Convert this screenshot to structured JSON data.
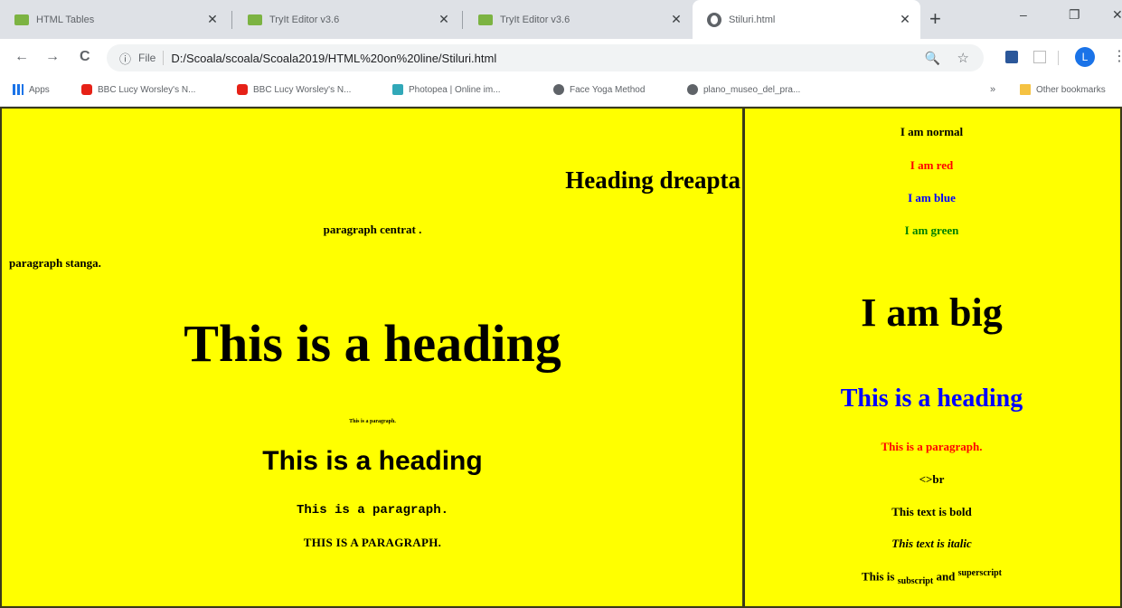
{
  "tabs": [
    {
      "title": "HTML Tables",
      "icon": "html-tables-favicon"
    },
    {
      "title": "TryIt Editor v3.6",
      "icon": "w3schools-favicon"
    },
    {
      "title": "TryIt Editor v3.6",
      "icon": "w3schools-favicon"
    },
    {
      "title": "Stiluri.html",
      "icon": "globe-icon"
    }
  ],
  "window_controls": {
    "minimize": "–",
    "maximize": "❐",
    "close": "✕"
  },
  "toolbar": {
    "back": "←",
    "forward": "→",
    "reload": "C",
    "info_icon": "ⓘ",
    "scheme_label": "File",
    "url": "D:/Scoala/scoala/Scoala2019/HTML%20on%20line/Stiluri.html",
    "profile_initial": "L"
  },
  "bookmarks": [
    {
      "label": "Apps",
      "icon": "apps"
    },
    {
      "label": "BBC Lucy Worsley's N...",
      "icon": "youtube"
    },
    {
      "label": "BBC Lucy Worsley's N...",
      "icon": "youtube"
    },
    {
      "label": "Photopea | Online im...",
      "icon": "photopea"
    },
    {
      "label": "Face Yoga Method",
      "icon": "globe"
    },
    {
      "label": "plano_museo_del_pra...",
      "icon": "globe"
    }
  ],
  "bookmarks_more": "»",
  "other_bookmarks": "Other bookmarks",
  "left_frame": {
    "heading_right": "Heading dreapta",
    "paragraph_center": "paragraph centrat .",
    "paragraph_left": "paragraph stanga.",
    "big_heading": "This is a heading",
    "tiny_paragraph": "This is a paragraph.",
    "sans_heading": "This is a heading",
    "mono_paragraph": "This is a paragraph.",
    "caps_paragraph": "THIS IS A PARAGRAPH."
  },
  "right_frame": {
    "normal": "I am normal",
    "red": "I am red",
    "blue": "I am blue",
    "green": "I am green",
    "big": "I am big",
    "heading": "This is a heading",
    "paragraph": "This is a paragraph.",
    "br_text": "<>br",
    "bold": "This text is bold",
    "italic": "This text is italic",
    "sub_sup": {
      "prefix": "This is ",
      "sub": "subscript",
      "middle": " and ",
      "sup": "superscript"
    }
  },
  "colors": {
    "page_background": "#ffff00",
    "red": "#ff0000",
    "blue": "#0000ff",
    "green": "#008000"
  }
}
